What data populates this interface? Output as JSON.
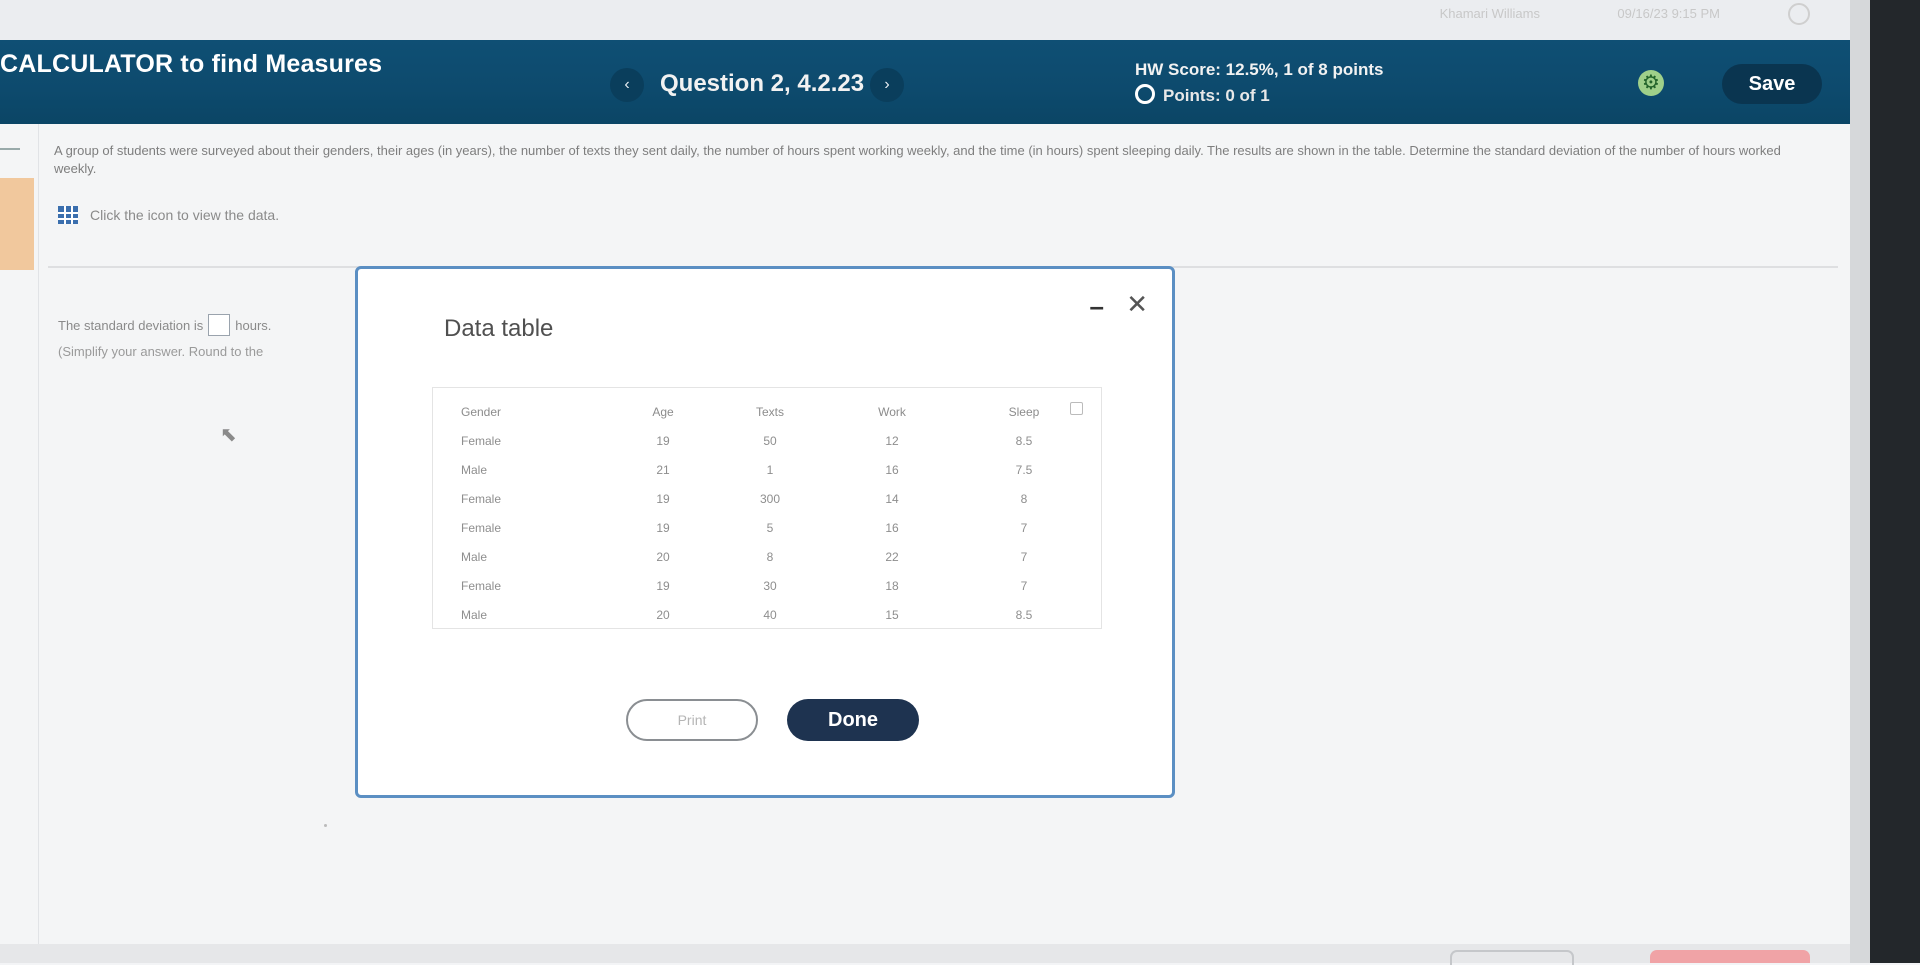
{
  "system_bar": {
    "user_name": "Khamari Williams",
    "datetime": "09/16/23 9:15 PM"
  },
  "header": {
    "app_title": "CALCULATOR to find Measures",
    "prev_glyph": "‹",
    "question_label": "Question 2, 4.2.23",
    "next_glyph": "›",
    "score_text": "HW Score: 12.5%, 1 of 8 points",
    "points_text": "Points: 0 of 1",
    "save_label": "Save",
    "colors": {
      "bar": "#0d4a6d",
      "save": "#0a3550"
    }
  },
  "problem": {
    "text": "A group of students were surveyed about their genders, their ages (in years), the number of texts they sent daily, the number of hours spent working weekly, and the time (in hours) spent sleeping daily. The results are shown in the table. Determine the standard deviation of the number of hours worked weekly.",
    "data_link": "Click the icon to view the data."
  },
  "answer": {
    "prefix": "The standard deviation is",
    "suffix": "hours.",
    "hint": "(Simplify your answer. Round to the"
  },
  "modal": {
    "title": "Data table",
    "minimize_glyph": "–",
    "close_glyph": "✕",
    "columns": [
      "Gender",
      "Age",
      "Texts",
      "Work",
      "Sleep"
    ],
    "rows": [
      [
        "Female",
        "19",
        "50",
        "12",
        "8.5"
      ],
      [
        "Male",
        "21",
        "1",
        "16",
        "7.5"
      ],
      [
        "Female",
        "19",
        "300",
        "14",
        "8"
      ],
      [
        "Female",
        "19",
        "5",
        "16",
        "7"
      ],
      [
        "Male",
        "20",
        "8",
        "22",
        "7"
      ],
      [
        "Female",
        "19",
        "30",
        "18",
        "7"
      ],
      [
        "Male",
        "20",
        "40",
        "15",
        "8.5"
      ]
    ],
    "print_label": "Print",
    "done_label": "Done",
    "colors": {
      "border": "#5b8fc3",
      "done": "#1e3350"
    }
  }
}
